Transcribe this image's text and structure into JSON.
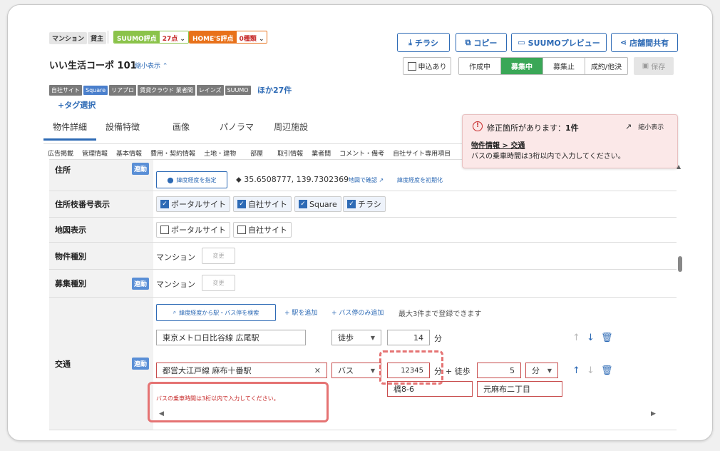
{
  "header": {
    "type_tag": "マンション",
    "owner_tag": "貸主",
    "suumo_score_label": "SUUMO評点",
    "suumo_score_value": "27点",
    "homes_score_label": "HOME'S評点",
    "homes_score_value": "0種類",
    "property_name": "いい生活コーポ 101",
    "collapse_link": "縮小表示",
    "add_tag": "+タグ選択",
    "more_sources": "ほか27件"
  },
  "toolbar": {
    "flyer": "チラシ",
    "copy": "コピー",
    "suumo_preview": "SUUMOプレビュー",
    "share": "店舗間共有",
    "apply_label": "申込あり",
    "status": [
      "作成中",
      "募集中",
      "募集止",
      "成約/他決"
    ],
    "active_status": "募集中",
    "save": "保存"
  },
  "sources": [
    "自社サイト",
    "Square",
    "リアプロ",
    "賃貸クラウド 業者間",
    "レインズ",
    "SUUMO"
  ],
  "tabs": [
    "物件詳細",
    "設備特徴",
    "画像",
    "パノラマ",
    "周辺施設"
  ],
  "subtabs": [
    "広告掲載",
    "管理情報",
    "基本情報",
    "費用・契約情報",
    "土地・建物",
    "部屋",
    "取引情報",
    "業者間",
    "コメント・備考",
    "自社サイト専用項目"
  ],
  "alert": {
    "title": "修正箇所があります：",
    "count": "1件",
    "collapse": "縮小表示",
    "link": "物件情報 > 交通",
    "message": "バスの乗車時間は3桁以内で入力してください。"
  },
  "rows": {
    "address": {
      "label": "住所",
      "linked": "連動",
      "set_coords": "緯度経度を指定",
      "coords": "35.6508777, 139.7302369",
      "map_check": "地図で確認",
      "reset_coords": "緯度経度を初期化"
    },
    "address_display": {
      "label": "住所枝番号表示",
      "options": [
        "ポータルサイト",
        "自社サイト",
        "Square",
        "チラシ"
      ]
    },
    "map_display": {
      "label": "地図表示",
      "options": [
        "ポータルサイト",
        "自社サイト"
      ]
    },
    "property_type": {
      "label": "物件種別",
      "value": "マンション",
      "change": "変更"
    },
    "recruit_type": {
      "label": "募集種別",
      "linked": "連動",
      "value": "マンション",
      "change": "変更"
    },
    "transport": {
      "label": "交通",
      "linked": "連動",
      "search_btn": "緯度経度から駅・バス停を検索",
      "add_station": "駅を追加",
      "add_bus": "バス停のみ追加",
      "limit_note": "最大3件まで登録できます",
      "line1": {
        "station": "東京メトロ日比谷線 広尾駅",
        "method": "徒歩",
        "minutes": "14",
        "unit": "分"
      },
      "line2": {
        "station": "都営大江戸線 麻布十番駅",
        "method": "バス",
        "minutes": "12345",
        "unit": "分",
        "plus": "+ 徒歩",
        "walk": "5",
        "walk_unit": "分",
        "bus_stop": "橋8-6",
        "bus_dest": "元麻布二丁目"
      },
      "error": "バスの乗車時間は3桁以内で入力してください。"
    }
  }
}
